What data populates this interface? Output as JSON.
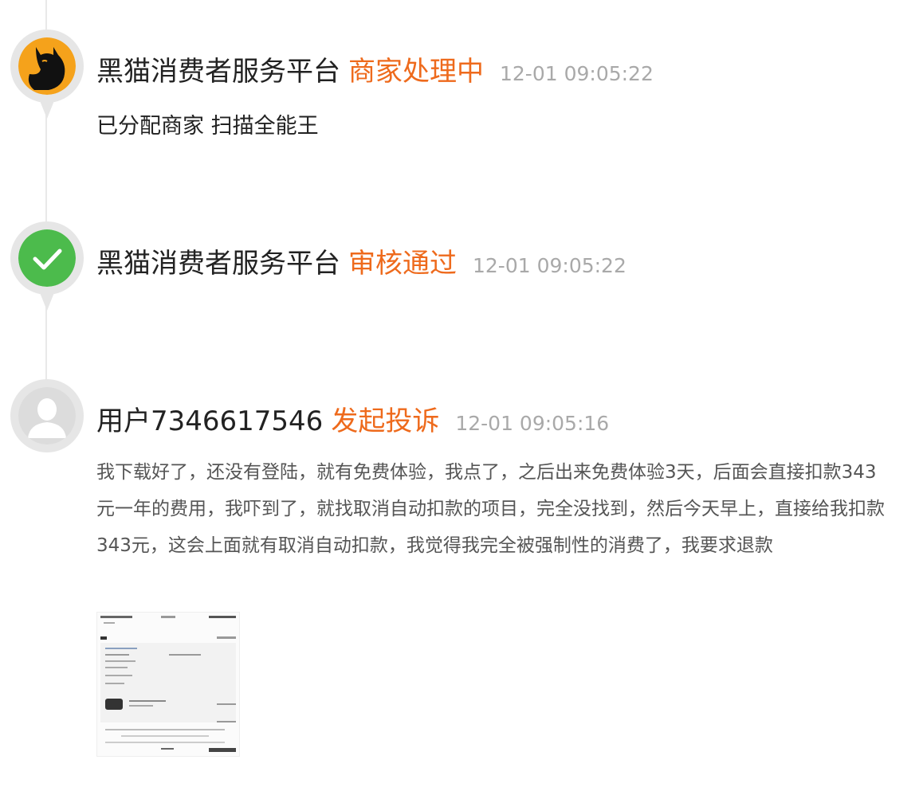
{
  "entries": [
    {
      "actor": "黑猫消费者服务平台",
      "action": "商家处理中",
      "time": "12-01 09:05:22",
      "detail": "已分配商家 扫描全能王",
      "avatar_icon": "black-cat-logo-icon"
    },
    {
      "actor": "黑猫消费者服务平台",
      "action": "审核通过",
      "time": "12-01 09:05:22",
      "avatar_icon": "green-check-icon"
    },
    {
      "actor": "用户7346617546",
      "action": "发起投诉",
      "time": "12-01 09:05:16",
      "detail": "我下载好了，还没有登陆，就有免费体验，我点了，之后出来免费体验3天，后面会直接扣款343元一年的费用，我吓到了，就找取消自动扣款的项目，完全没找到，然后今天早上，直接给我扣款343元，这会上面就有取消自动扣款，我觉得我完全被强制性的消费了，我要求退款",
      "avatar_icon": "default-user-avatar-icon",
      "attachment_icon": "screenshot-thumbnail-icon"
    }
  ],
  "colors": {
    "action": "#ee6a1c",
    "time": "#a9a9a9",
    "actor": "#222222",
    "cat_bg": "#f5a21b",
    "check_bg": "#4cbb4c",
    "ring": "#e6e6e6"
  }
}
